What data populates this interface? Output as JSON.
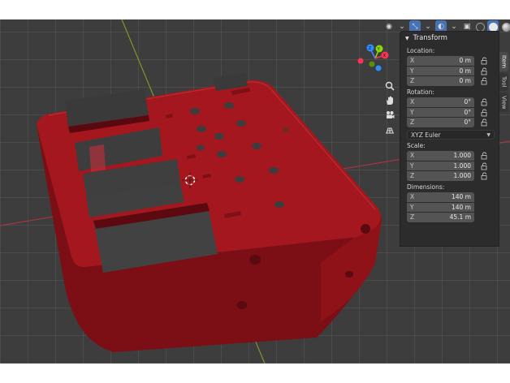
{
  "panel": {
    "title": "Transform",
    "location": {
      "label": "Location:",
      "rows": [
        {
          "axis": "X",
          "value": "0 m"
        },
        {
          "axis": "Y",
          "value": "0 m"
        },
        {
          "axis": "Z",
          "value": "0 m"
        }
      ]
    },
    "rotation": {
      "label": "Rotation:",
      "rows": [
        {
          "axis": "X",
          "value": "0°"
        },
        {
          "axis": "Y",
          "value": "0°"
        },
        {
          "axis": "Z",
          "value": "0°"
        }
      ],
      "mode": "XYZ Euler"
    },
    "scale": {
      "label": "Scale:",
      "rows": [
        {
          "axis": "X",
          "value": "1.000"
        },
        {
          "axis": "Y",
          "value": "1.000"
        },
        {
          "axis": "Z",
          "value": "1.000"
        }
      ]
    },
    "dimensions": {
      "label": "Dimensions:",
      "rows": [
        {
          "axis": "X",
          "value": "140 m"
        },
        {
          "axis": "Y",
          "value": "140 m"
        },
        {
          "axis": "Z",
          "value": "45.1 m"
        }
      ]
    }
  },
  "tabs": [
    {
      "label": "Item",
      "active": true
    },
    {
      "label": "Tool",
      "active": false
    },
    {
      "label": "View",
      "active": false
    }
  ],
  "gizmo": {
    "axes": [
      {
        "label": "Y",
        "color": "#8bdc00"
      },
      {
        "label": "Z",
        "color": "#2c8fff"
      },
      {
        "label": "X",
        "color": "#ff3352"
      }
    ]
  },
  "toolbar_icons": [
    "zoom-icon",
    "hand-icon",
    "camera-icon",
    "grid-icon"
  ],
  "colors": {
    "model": "#a3151f",
    "model_shadow": "#6e0d12",
    "accent": "#4772b3",
    "axis_x": "#c43a48",
    "axis_y": "#86a91f"
  }
}
